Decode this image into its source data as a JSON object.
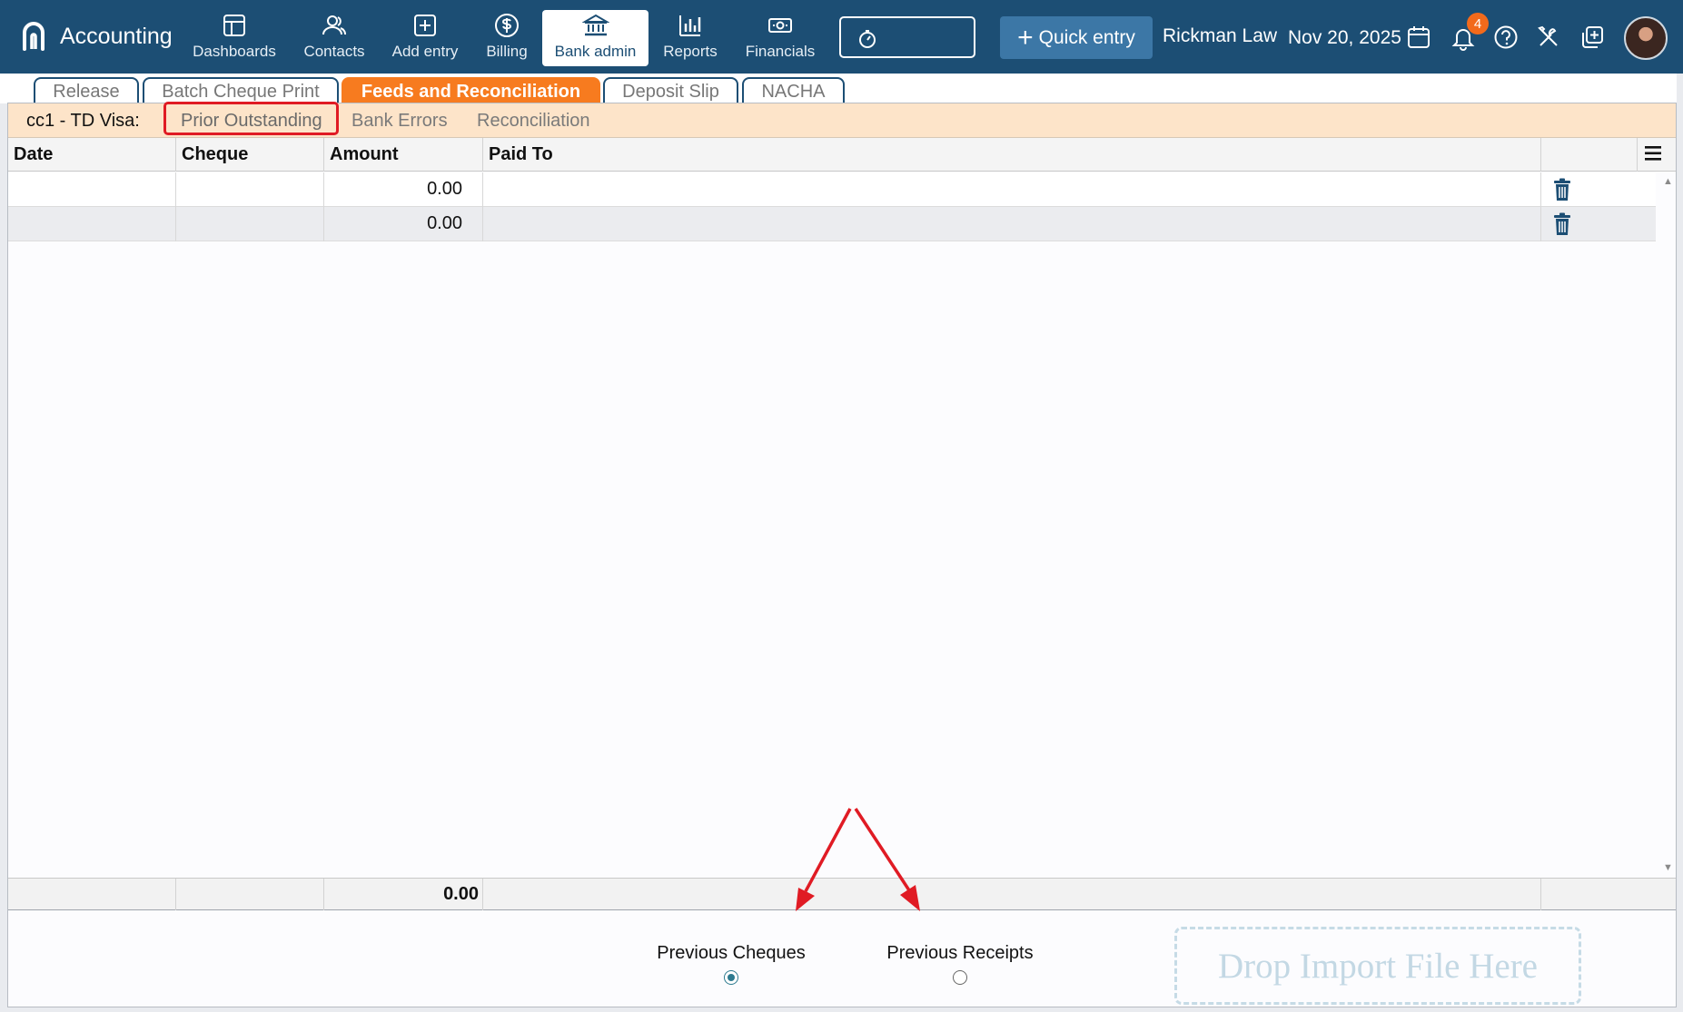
{
  "app": {
    "title": "Accounting"
  },
  "nav": [
    {
      "label": "Dashboards",
      "icon": "dashboard-icon"
    },
    {
      "label": "Contacts",
      "icon": "contacts-icon"
    },
    {
      "label": "Add entry",
      "icon": "add-entry-icon"
    },
    {
      "label": "Billing",
      "icon": "dollar-icon"
    },
    {
      "label": "Bank admin",
      "icon": "bank-icon",
      "active": true
    },
    {
      "label": "Reports",
      "icon": "bar-chart-icon"
    },
    {
      "label": "Financials",
      "icon": "money-icon"
    }
  ],
  "header": {
    "quick_entry": "Quick entry",
    "firm": "Rickman Law",
    "date": "Nov 20, 2025",
    "notifications": "4"
  },
  "module_tabs": [
    {
      "label": "Release"
    },
    {
      "label": "Batch Cheque Print"
    },
    {
      "label": "Feeds and Reconciliation",
      "active": true
    },
    {
      "label": "Deposit Slip"
    },
    {
      "label": "NACHA"
    }
  ],
  "subbar": {
    "account": "cc1 - TD Visa:",
    "tabs": [
      "Prior Outstanding",
      "Bank Errors",
      "Reconciliation"
    ],
    "active_tab": "Prior Outstanding"
  },
  "grid": {
    "columns": [
      "Date",
      "Cheque",
      "Amount",
      "Paid To"
    ],
    "rows": [
      {
        "date": "",
        "cheque": "",
        "amount": "0.00",
        "paid_to": ""
      },
      {
        "date": "",
        "cheque": "",
        "amount": "0.00",
        "paid_to": ""
      }
    ],
    "total_amount": "0.00"
  },
  "options": {
    "previous_cheques": "Previous Cheques",
    "previous_receipts": "Previous Receipts",
    "selected": "Previous Cheques"
  },
  "dropzone": {
    "label": "Drop Import File Here"
  },
  "colors": {
    "topbar": "#1c4e74",
    "accent_orange": "#f77b1f",
    "highlight_red": "#e01b24",
    "subbar": "#fde4c9",
    "quick_entry": "#3c77a6"
  }
}
